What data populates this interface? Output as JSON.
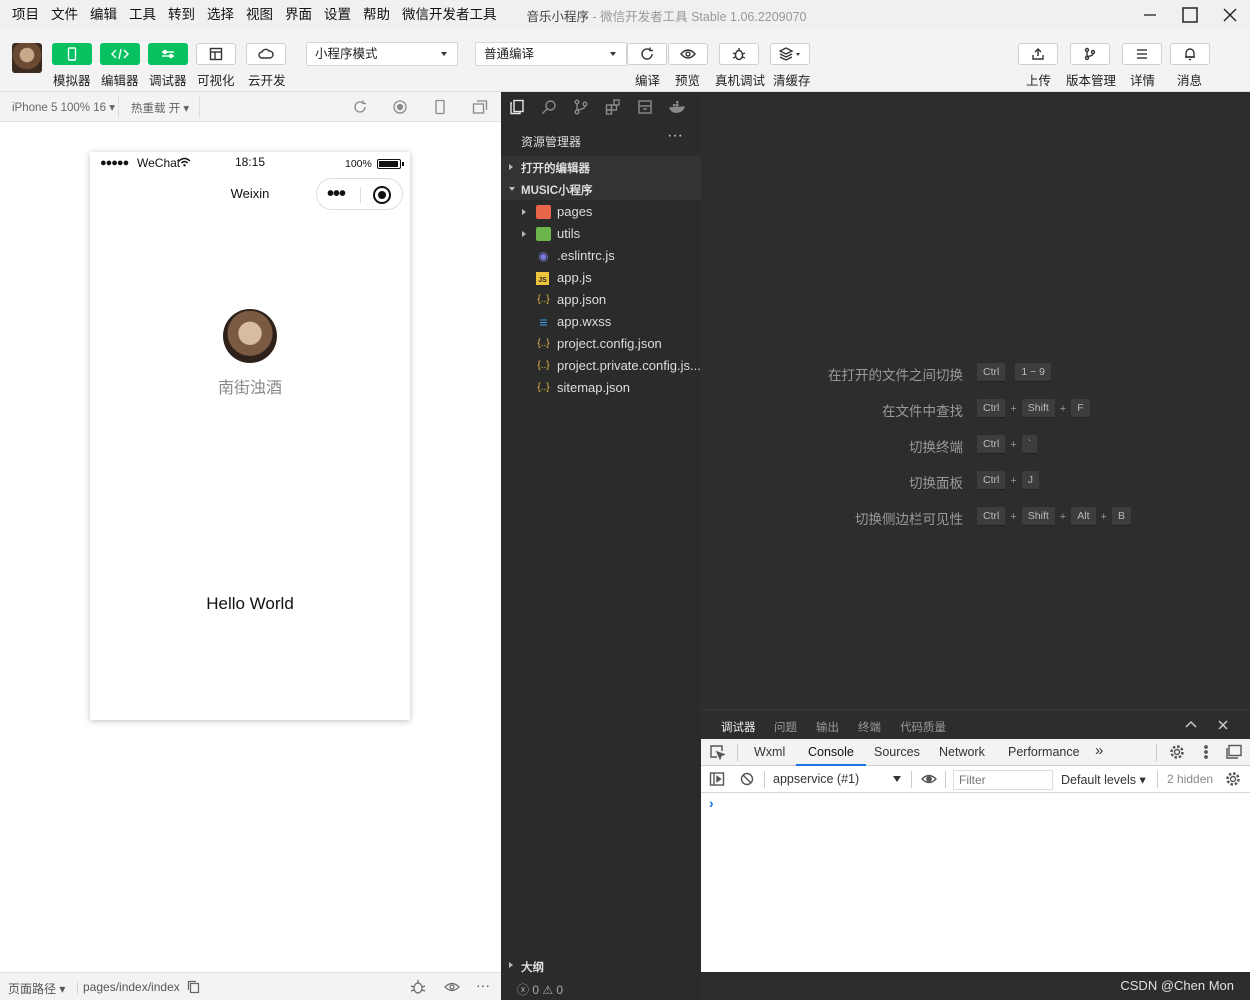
{
  "menubar": {
    "items": [
      "项目",
      "文件",
      "编辑",
      "工具",
      "转到",
      "选择",
      "视图",
      "界面",
      "设置",
      "帮助",
      "微信开发者工具"
    ],
    "title": "音乐小程序",
    "title_sub": " - 微信开发者工具 Stable 1.06.2209070"
  },
  "toolbar": {
    "simulator": "模拟器",
    "editor": "编辑器",
    "debugger": "调试器",
    "visual": "可视化",
    "cloud": "云开发",
    "mode_select": "小程序模式",
    "compile_select": "普通编译",
    "compile": "编译",
    "preview": "预览",
    "remote_debug": "真机调试",
    "clear_cache": "清缓存",
    "upload": "上传",
    "version": "版本管理",
    "details": "详情",
    "messages": "消息"
  },
  "simulator": {
    "device": "iPhone 5 100% 16 ▾",
    "hot_reload": "热重载 开 ▾",
    "status": {
      "dots": "●●●●●",
      "carrier": "WeChat",
      "time": "18:15",
      "battery": "100%"
    },
    "nav_title": "Weixin",
    "capsule_more": "•••",
    "nickname": "南街浊酒",
    "hello": "Hello World",
    "footer_path_label": "页面路径 ▾",
    "footer_path": "pages/index/index"
  },
  "explorer": {
    "header": "资源管理器",
    "header_more": "···",
    "open_editors": "打开的编辑器",
    "project": "MUSIC小程序",
    "folders": [
      {
        "name": "pages",
        "color": "#e8644a"
      },
      {
        "name": "utils",
        "color": "#6bb54a"
      }
    ],
    "files": [
      {
        "name": ".eslintrc.js",
        "icon": "◉",
        "color": "#7b7bdf"
      },
      {
        "name": "app.js",
        "icon": "JS",
        "color": "#f0c43a"
      },
      {
        "name": "app.json",
        "icon": "{..}",
        "color": "#e8b84a"
      },
      {
        "name": "app.wxss",
        "icon": "≡",
        "color": "#3b9bdc"
      },
      {
        "name": "project.config.json",
        "icon": "{..}",
        "color": "#e8b84a"
      },
      {
        "name": "project.private.config.js...",
        "icon": "{..}",
        "color": "#e8b84a"
      },
      {
        "name": "sitemap.json",
        "icon": "{..}",
        "color": "#e8b84a"
      }
    ],
    "outline": "大纲",
    "status": "ⓧ 0 ⚠ 0"
  },
  "editor": {
    "shortcuts": [
      {
        "label": "在打开的文件之间切换",
        "keys": [
          "Ctrl",
          "1 ~ 9"
        ]
      },
      {
        "label": "在文件中查找",
        "keys": [
          "Ctrl",
          "Shift",
          "F"
        ]
      },
      {
        "label": "切换终端",
        "keys": [
          "Ctrl",
          "`"
        ]
      },
      {
        "label": "切换面板",
        "keys": [
          "Ctrl",
          "J"
        ]
      },
      {
        "label": "切换侧边栏可见性",
        "keys": [
          "Ctrl",
          "Shift",
          "Alt",
          "B"
        ]
      }
    ]
  },
  "debugger": {
    "tabs": [
      "调试器",
      "问题",
      "输出",
      "终端",
      "代码质量"
    ],
    "devtools_tabs": [
      "Wxml",
      "Console",
      "Sources",
      "Network",
      "Performance"
    ],
    "more_tabs": "»",
    "context": "appservice (#1)",
    "filter_placeholder": "Filter",
    "levels": "Default levels ▾",
    "hidden": "2 hidden",
    "prompt": "›"
  },
  "watermark": "CSDN @Chen Mon",
  "colors": {
    "accent_green": "#07c160",
    "dark_bg": "#2d2d2d",
    "devtools_blue": "#1a73e8"
  }
}
